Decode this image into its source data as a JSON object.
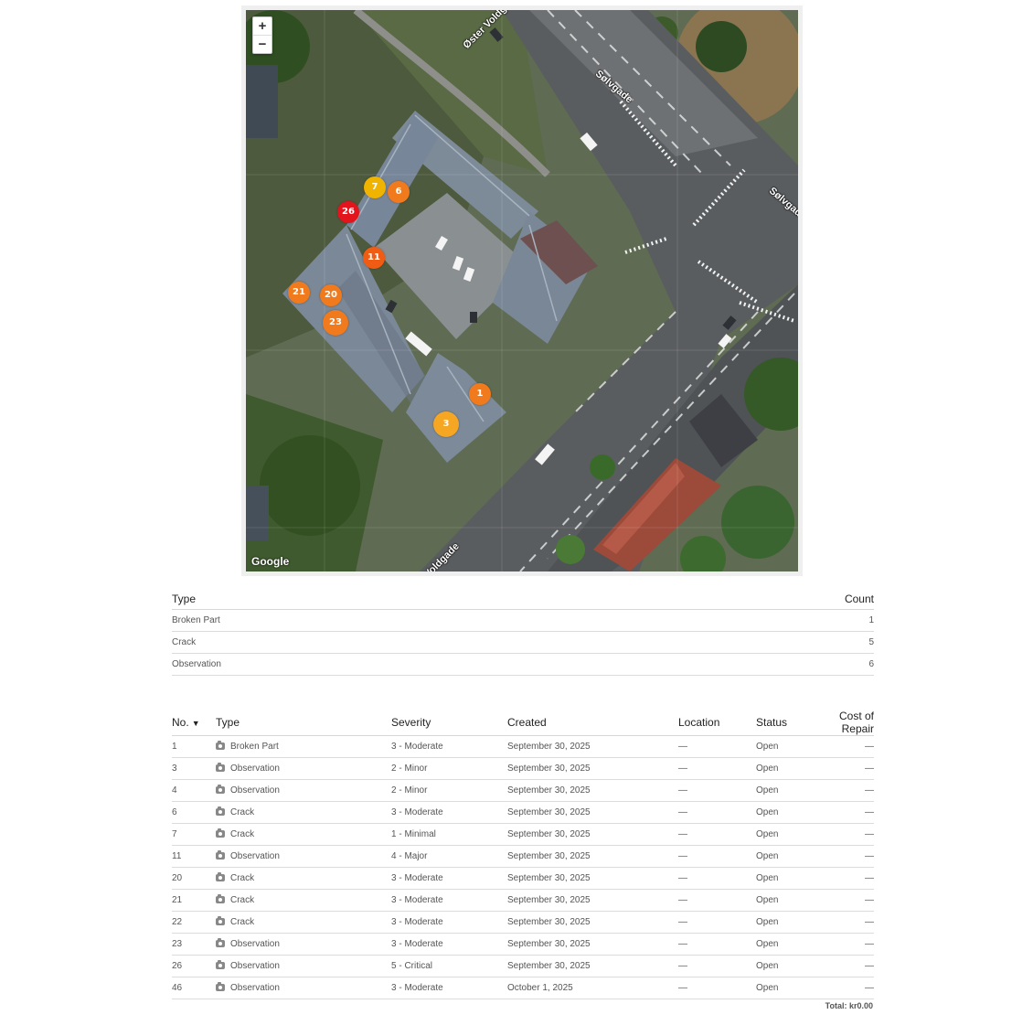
{
  "map": {
    "zoom_in": "+",
    "zoom_out": "−",
    "attribution": "Google",
    "streets": [
      "Sølvgade",
      "Sølvgade",
      "Øster Voldgade",
      "Voldgade"
    ],
    "markers": [
      {
        "label": "7",
        "color": "#f0b400"
      },
      {
        "label": "6",
        "color": "#f07a1c"
      },
      {
        "label": "26",
        "color": "#e3141c"
      },
      {
        "label": "11",
        "color": "#f05c14"
      },
      {
        "label": "21",
        "color": "#f07a1c"
      },
      {
        "label": "20",
        "color": "#f07a1c"
      },
      {
        "label": "23",
        "color": "#f07a1c"
      },
      {
        "label": "1",
        "color": "#f07a1c"
      },
      {
        "label": "3",
        "color": "#f5a623"
      }
    ]
  },
  "summary": {
    "headers": {
      "type": "Type",
      "count": "Count"
    },
    "rows": [
      {
        "type": "Broken Part",
        "count": "1"
      },
      {
        "type": "Crack",
        "count": "5"
      },
      {
        "type": "Observation",
        "count": "6"
      }
    ]
  },
  "detail": {
    "headers": {
      "no": "No.",
      "type": "Type",
      "severity": "Severity",
      "created": "Created",
      "location": "Location",
      "status": "Status",
      "cost": "Cost of Repair"
    },
    "sort_arrow": "▼",
    "rows": [
      {
        "no": "1",
        "type": "Broken Part",
        "severity": "3 - Moderate",
        "created": "September 30, 2025",
        "location": "—",
        "status": "Open",
        "cost": "—"
      },
      {
        "no": "3",
        "type": "Observation",
        "severity": "2 - Minor",
        "created": "September 30, 2025",
        "location": "—",
        "status": "Open",
        "cost": "—"
      },
      {
        "no": "4",
        "type": "Observation",
        "severity": "2 - Minor",
        "created": "September 30, 2025",
        "location": "—",
        "status": "Open",
        "cost": "—"
      },
      {
        "no": "6",
        "type": "Crack",
        "severity": "3 - Moderate",
        "created": "September 30, 2025",
        "location": "—",
        "status": "Open",
        "cost": "—"
      },
      {
        "no": "7",
        "type": "Crack",
        "severity": "1 - Minimal",
        "created": "September 30, 2025",
        "location": "—",
        "status": "Open",
        "cost": "—"
      },
      {
        "no": "11",
        "type": "Observation",
        "severity": "4 - Major",
        "created": "September 30, 2025",
        "location": "—",
        "status": "Open",
        "cost": "—"
      },
      {
        "no": "20",
        "type": "Crack",
        "severity": "3 - Moderate",
        "created": "September 30, 2025",
        "location": "—",
        "status": "Open",
        "cost": "—"
      },
      {
        "no": "21",
        "type": "Crack",
        "severity": "3 - Moderate",
        "created": "September 30, 2025",
        "location": "—",
        "status": "Open",
        "cost": "—"
      },
      {
        "no": "22",
        "type": "Crack",
        "severity": "3 - Moderate",
        "created": "September 30, 2025",
        "location": "—",
        "status": "Open",
        "cost": "—"
      },
      {
        "no": "23",
        "type": "Observation",
        "severity": "3 - Moderate",
        "created": "September 30, 2025",
        "location": "—",
        "status": "Open",
        "cost": "—"
      },
      {
        "no": "26",
        "type": "Observation",
        "severity": "5 - Critical",
        "created": "September 30, 2025",
        "location": "—",
        "status": "Open",
        "cost": "—"
      },
      {
        "no": "46",
        "type": "Observation",
        "severity": "3 - Moderate",
        "created": "October 1, 2025",
        "location": "—",
        "status": "Open",
        "cost": "—"
      }
    ],
    "total": "Total: kr0.00"
  }
}
